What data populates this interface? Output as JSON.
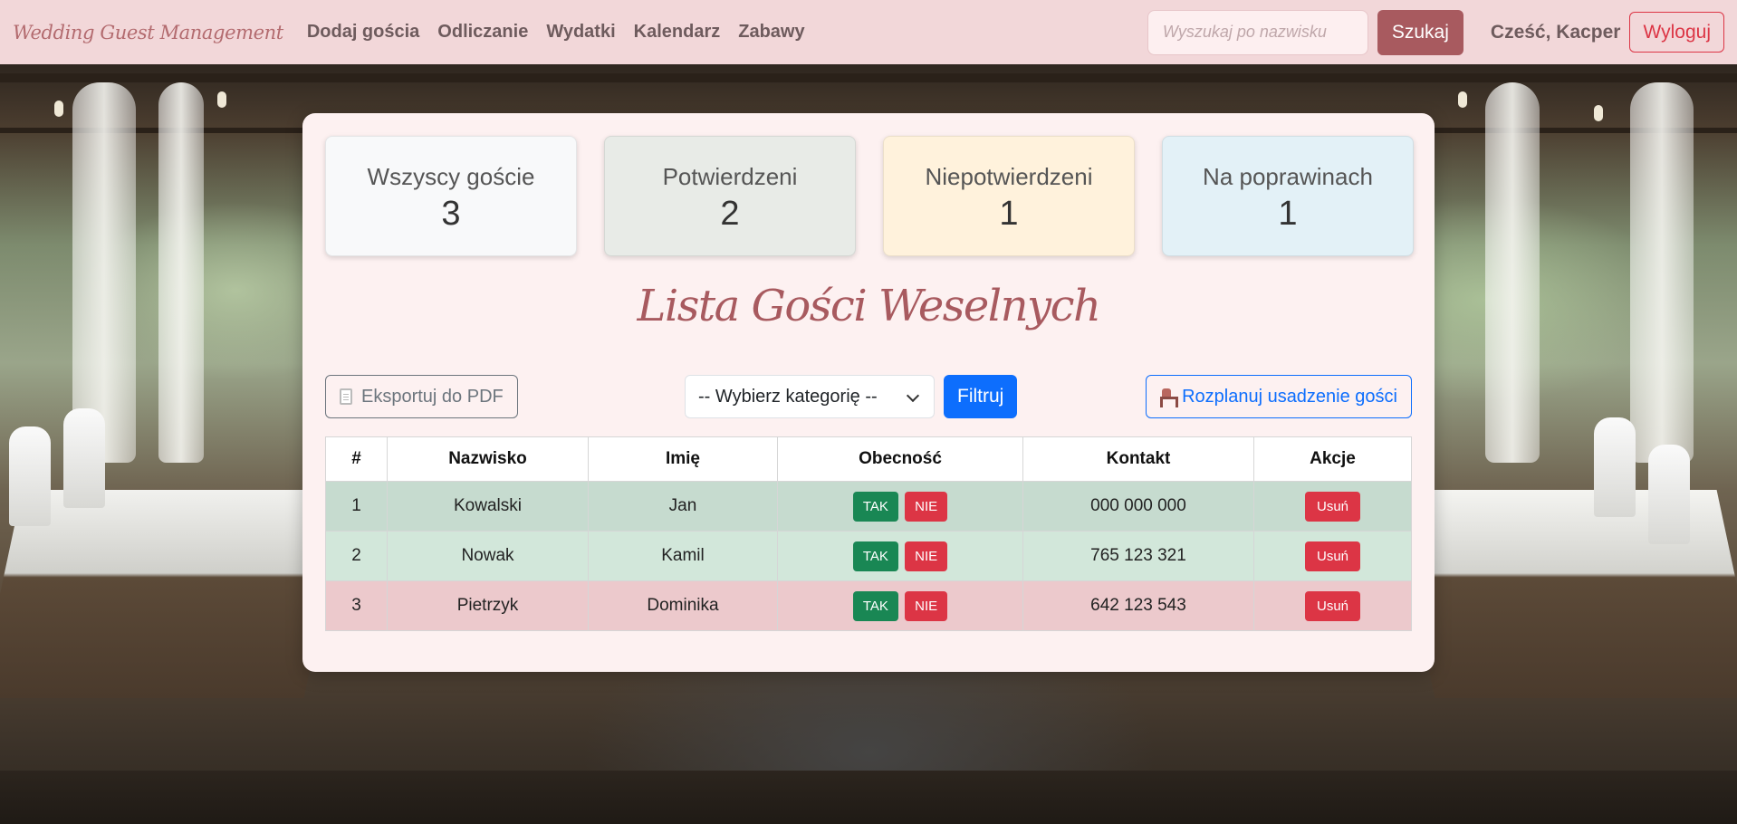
{
  "navbar": {
    "brand": "Wedding Guest Management",
    "links": [
      "Dodaj gościa",
      "Odliczanie",
      "Wydatki",
      "Kalendarz",
      "Zabawy"
    ],
    "search_placeholder": "Wyszukaj po nazwisku",
    "search_button": "Szukaj",
    "greeting": "Cześć, Kacper",
    "logout_button": "Wyloguj"
  },
  "stats": [
    {
      "label": "Wszyscy goście",
      "value": "3",
      "color": "#f8f9fa"
    },
    {
      "label": "Potwierdzeni",
      "value": "2",
      "color": "#e8ebe7"
    },
    {
      "label": "Niepotwierdzeni",
      "value": "1",
      "color": "#fff2dc"
    },
    {
      "label": "Na poprawinach",
      "value": "1",
      "color": "#e3f1f7"
    }
  ],
  "title": "Lista Gości Weselnych",
  "toolbar": {
    "export_button": "Eksportuj do PDF",
    "category_select": "-- Wybierz kategorię --",
    "filter_button": "Filtruj",
    "seating_button": "Rozplanuj usadzenie gości"
  },
  "table": {
    "headers": [
      "#",
      "Nazwisko",
      "Imię",
      "Obecność",
      "Kontakt",
      "Akcje"
    ],
    "rows": [
      {
        "num": "1",
        "surname": "Kowalski",
        "name": "Jan",
        "contact": "000 000 000"
      },
      {
        "num": "2",
        "surname": "Nowak",
        "name": "Kamil",
        "contact": "765 123 321"
      },
      {
        "num": "3",
        "surname": "Pietrzyk",
        "name": "Dominika",
        "contact": "642 123 543"
      }
    ],
    "yes_label": "TAK",
    "no_label": "NIE",
    "delete_label": "Usuń"
  },
  "colors": {
    "navbar_bg": "#f2d7d9",
    "accent": "#a85a5f",
    "primary": "#0d6efd",
    "success": "#198754",
    "danger": "#dc3545"
  }
}
